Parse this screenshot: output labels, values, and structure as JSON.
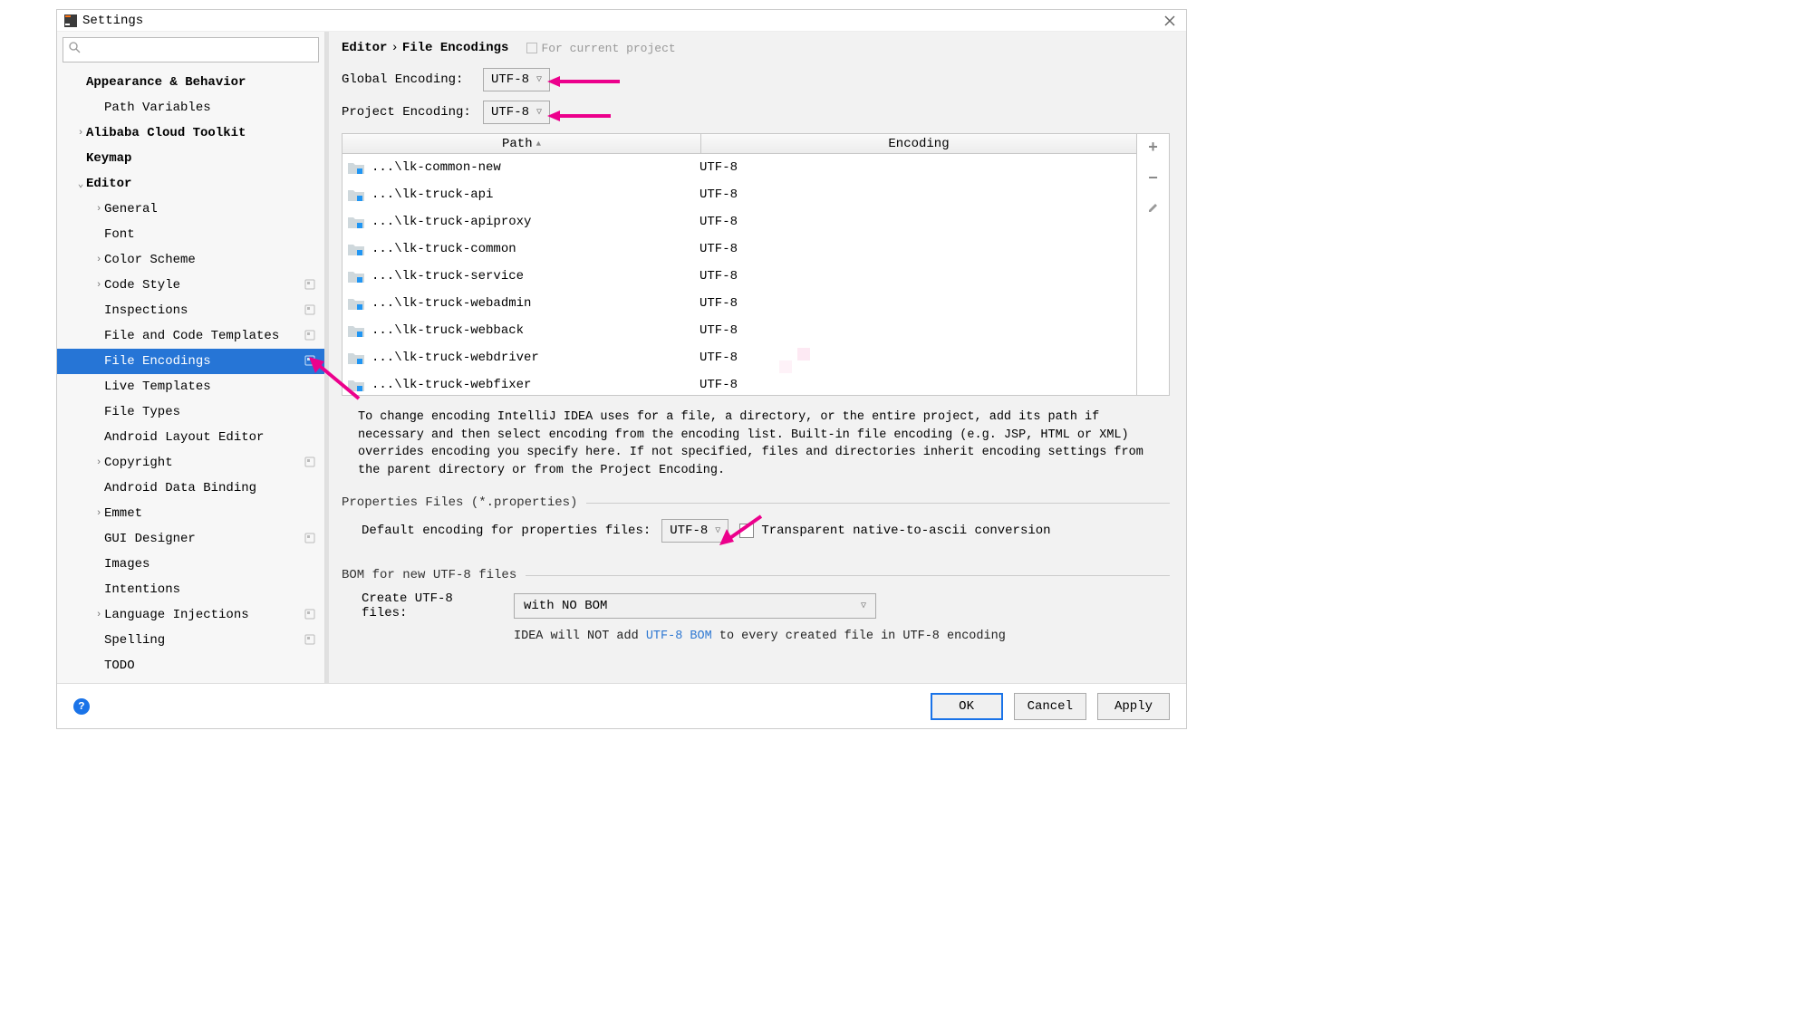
{
  "title": "Settings",
  "tree": [
    {
      "label": "Appearance & Behavior",
      "depth": 0,
      "bold": true,
      "exp": ""
    },
    {
      "label": "Path Variables",
      "depth": 1,
      "bold": false,
      "exp": ""
    },
    {
      "label": "Alibaba Cloud Toolkit",
      "depth": 0,
      "bold": true,
      "exp": "›"
    },
    {
      "label": "Keymap",
      "depth": 0,
      "bold": true,
      "exp": ""
    },
    {
      "label": "Editor",
      "depth": 0,
      "bold": true,
      "exp": "⌄"
    },
    {
      "label": "General",
      "depth": 1,
      "bold": false,
      "exp": "›"
    },
    {
      "label": "Font",
      "depth": 1,
      "bold": false,
      "exp": ""
    },
    {
      "label": "Color Scheme",
      "depth": 1,
      "bold": false,
      "exp": "›"
    },
    {
      "label": "Code Style",
      "depth": 1,
      "bold": false,
      "exp": "›",
      "badge": true
    },
    {
      "label": "Inspections",
      "depth": 1,
      "bold": false,
      "exp": "",
      "badge": true
    },
    {
      "label": "File and Code Templates",
      "depth": 1,
      "bold": false,
      "exp": "",
      "badge": true
    },
    {
      "label": "File Encodings",
      "depth": 1,
      "bold": false,
      "exp": "",
      "badge": true,
      "selected": true
    },
    {
      "label": "Live Templates",
      "depth": 1,
      "bold": false,
      "exp": ""
    },
    {
      "label": "File Types",
      "depth": 1,
      "bold": false,
      "exp": ""
    },
    {
      "label": "Android Layout Editor",
      "depth": 1,
      "bold": false,
      "exp": ""
    },
    {
      "label": "Copyright",
      "depth": 1,
      "bold": false,
      "exp": "›",
      "badge": true
    },
    {
      "label": "Android Data Binding",
      "depth": 1,
      "bold": false,
      "exp": ""
    },
    {
      "label": "Emmet",
      "depth": 1,
      "bold": false,
      "exp": "›"
    },
    {
      "label": "GUI Designer",
      "depth": 1,
      "bold": false,
      "exp": "",
      "badge": true
    },
    {
      "label": "Images",
      "depth": 1,
      "bold": false,
      "exp": ""
    },
    {
      "label": "Intentions",
      "depth": 1,
      "bold": false,
      "exp": ""
    },
    {
      "label": "Language Injections",
      "depth": 1,
      "bold": false,
      "exp": "›",
      "badge": true
    },
    {
      "label": "Spelling",
      "depth": 1,
      "bold": false,
      "exp": "",
      "badge": true
    },
    {
      "label": "TODO",
      "depth": 1,
      "bold": false,
      "exp": ""
    }
  ],
  "breadcrumb": {
    "a": "Editor",
    "b": "File Encodings"
  },
  "scope": "For current project",
  "labels": {
    "global": "Global Encoding:",
    "project": "Project Encoding:",
    "path": "Path",
    "encoding": "Encoding",
    "propSection": "Properties Files (*.properties)",
    "propDefault": "Default encoding for properties files:",
    "transparent": "Transparent native-to-ascii conversion",
    "bomSection": "BOM for new UTF-8 files",
    "createFiles": "Create UTF-8 files:",
    "bomNote1": "IDEA will NOT add ",
    "bomLink": "UTF-8 BOM",
    "bomNote2": " to every created file in UTF-8 encoding"
  },
  "selects": {
    "global": "UTF-8",
    "project": "UTF-8",
    "prop": "UTF-8",
    "bom": "with NO BOM"
  },
  "desc": "To change encoding IntelliJ IDEA uses for a file, a directory, or the entire project, add its path if necessary and then select encoding from the encoding list. Built-in file encoding (e.g. JSP, HTML or XML) overrides encoding you specify here. If not specified, files and directories inherit encoding settings from the parent directory or from the Project Encoding.",
  "rows": [
    {
      "path": "...\\lk-common-new",
      "enc": "UTF-8"
    },
    {
      "path": "...\\lk-truck-api",
      "enc": "UTF-8"
    },
    {
      "path": "...\\lk-truck-apiproxy",
      "enc": "UTF-8"
    },
    {
      "path": "...\\lk-truck-common",
      "enc": "UTF-8"
    },
    {
      "path": "...\\lk-truck-service",
      "enc": "UTF-8"
    },
    {
      "path": "...\\lk-truck-webadmin",
      "enc": "UTF-8"
    },
    {
      "path": "...\\lk-truck-webback",
      "enc": "UTF-8"
    },
    {
      "path": "...\\lk-truck-webdriver",
      "enc": "UTF-8"
    },
    {
      "path": "...\\lk-truck-webfixer",
      "enc": "UTF-8"
    }
  ],
  "buttons": {
    "ok": "OK",
    "cancel": "Cancel",
    "apply": "Apply"
  }
}
